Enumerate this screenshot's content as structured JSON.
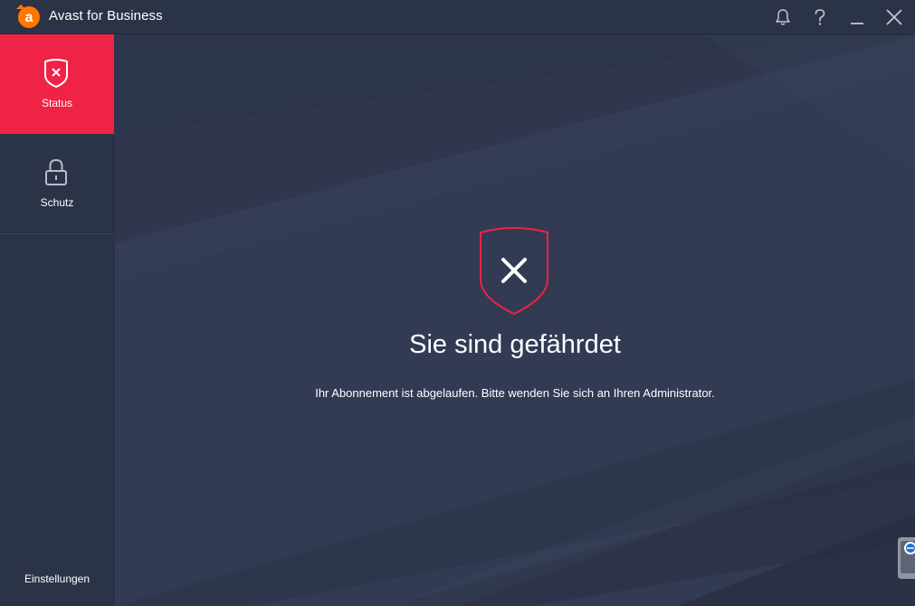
{
  "app": {
    "title": "Avast for Business",
    "accent_color": "#ef2345",
    "logo_color": "#ff7800",
    "logo_letter": "a"
  },
  "titlebar": {
    "notifications_icon": "bell-icon",
    "help_icon": "question-mark-icon",
    "minimize_icon": "minimize-icon",
    "close_icon": "close-icon"
  },
  "sidebar": {
    "items": [
      {
        "label": "Status",
        "icon": "shield-x-icon",
        "active": true
      },
      {
        "label": "Schutz",
        "icon": "lock-icon",
        "active": false
      }
    ],
    "settings_label": "Einstellungen"
  },
  "main": {
    "status_icon": "shield-x-icon",
    "status_color": "#ef2345",
    "title": "Sie sind gefährdet",
    "message": "Ihr Abonnement ist abgelaufen. Bitte wenden Sie sich an Ihren Administrator."
  }
}
